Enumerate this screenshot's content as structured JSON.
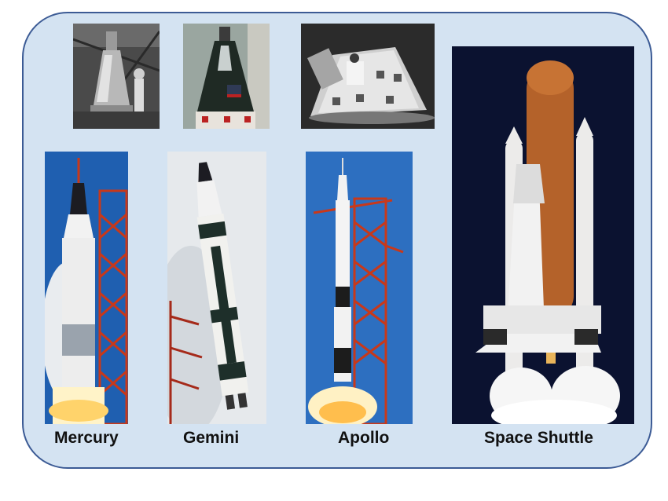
{
  "labels": {
    "mercury": "Mercury",
    "gemini": "Gemini",
    "apollo": "Apollo",
    "shuttle": "Space Shuttle"
  },
  "colors": {
    "panel_fill": "#d4e3f2",
    "panel_border": "#3c5b95",
    "sky_blue": "#1f5fb0",
    "night_sky": "#0b1230",
    "tower_red": "#c8381a",
    "external_tank": "#b4622a"
  },
  "photos": [
    {
      "name": "mercury-capsule-photo",
      "style": "black-and-white"
    },
    {
      "name": "gemini-capsule-photo",
      "style": "color"
    },
    {
      "name": "apollo-capsule-photo",
      "style": "black-and-white"
    },
    {
      "name": "mercury-launch-photo",
      "style": "color"
    },
    {
      "name": "gemini-launch-photo",
      "style": "color"
    },
    {
      "name": "apollo-launch-photo",
      "style": "color"
    },
    {
      "name": "shuttle-launch-photo",
      "style": "color"
    }
  ]
}
